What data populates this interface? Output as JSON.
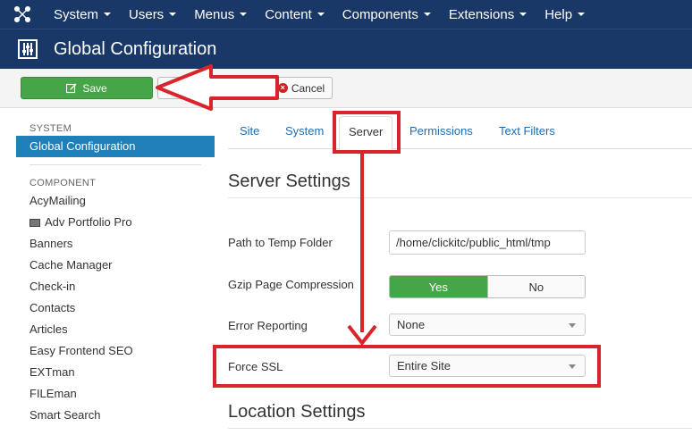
{
  "topnav": {
    "items": [
      {
        "label": "System"
      },
      {
        "label": "Users"
      },
      {
        "label": "Menus"
      },
      {
        "label": "Content"
      },
      {
        "label": "Components"
      },
      {
        "label": "Extensions"
      },
      {
        "label": "Help"
      }
    ]
  },
  "header": {
    "title": "Global Configuration",
    "icon": "sliders-icon"
  },
  "toolbar": {
    "save_label": "Save",
    "cancel_label": "Cancel"
  },
  "sidebar": {
    "system_heading": "SYSTEM",
    "system_items": [
      {
        "label": "Global Configuration",
        "active": true
      }
    ],
    "component_heading": "COMPONENT",
    "component_items": [
      {
        "label": "AcyMailing"
      },
      {
        "label": "Adv Portfolio Pro",
        "icon": "image-icon"
      },
      {
        "label": "Banners"
      },
      {
        "label": "Cache Manager"
      },
      {
        "label": "Check-in"
      },
      {
        "label": "Contacts"
      },
      {
        "label": "Articles"
      },
      {
        "label": "Easy Frontend SEO"
      },
      {
        "label": "EXTman"
      },
      {
        "label": "FILEman"
      },
      {
        "label": "Smart Search"
      }
    ]
  },
  "tabs": [
    {
      "label": "Site"
    },
    {
      "label": "System"
    },
    {
      "label": "Server",
      "active": true
    },
    {
      "label": "Permissions"
    },
    {
      "label": "Text Filters"
    }
  ],
  "server_settings": {
    "title": "Server Settings",
    "temp_folder_label": "Path to Temp Folder",
    "temp_folder_value": "/home/clickitc/public_html/tmp",
    "gzip_label": "Gzip Page Compression",
    "gzip_yes": "Yes",
    "gzip_no": "No",
    "error_label": "Error Reporting",
    "error_value": "None",
    "ssl_label": "Force SSL",
    "ssl_value": "Entire Site"
  },
  "location_settings": {
    "title": "Location Settings"
  },
  "colors": {
    "navbar": "#1a3867",
    "save_green": "#46a546",
    "active_blue": "#1f7fb8",
    "link_blue": "#1f6eb0",
    "annotation_red": "#d9242c"
  }
}
